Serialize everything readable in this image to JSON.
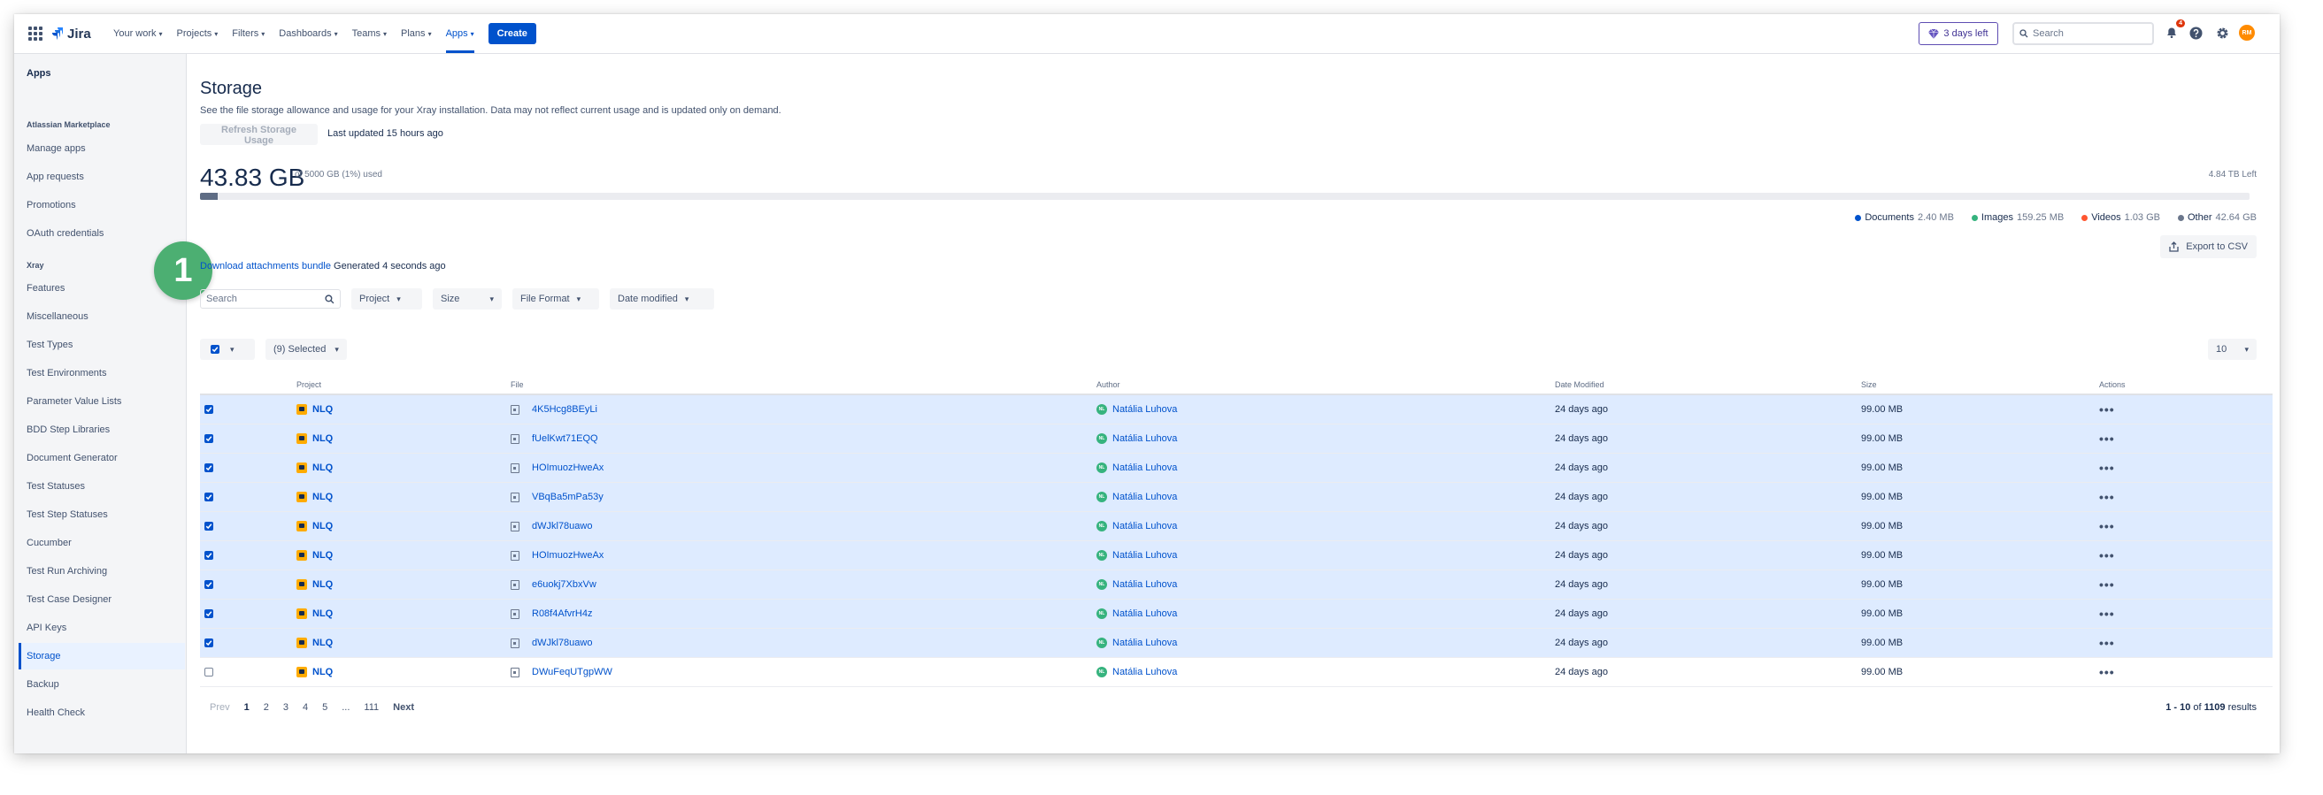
{
  "nav": {
    "logo": "Jira",
    "items": [
      {
        "label": "Your work"
      },
      {
        "label": "Projects"
      },
      {
        "label": "Filters"
      },
      {
        "label": "Dashboards"
      },
      {
        "label": "Teams"
      },
      {
        "label": "Plans"
      },
      {
        "label": "Apps",
        "active": true
      }
    ],
    "create_label": "Create",
    "trial_label": "3 days left",
    "search_placeholder": "Search",
    "notifications_count": "4",
    "avatar_initials": "RM"
  },
  "sidebar": {
    "title": "Apps",
    "sections": [
      {
        "label": "Atlassian Marketplace",
        "items": [
          "Manage apps",
          "App requests",
          "Promotions",
          "OAuth credentials"
        ]
      },
      {
        "label": "Xray",
        "items": [
          "Features",
          "Miscellaneous",
          "Test Types",
          "Test Environments",
          "Parameter Value Lists",
          "BDD Step Libraries",
          "Document Generator",
          "Test Statuses",
          "Test Step Statuses",
          "Cucumber",
          "Test Run Archiving",
          "Test Case Designer",
          "API Keys",
          "Storage",
          "Backup",
          "Health Check"
        ]
      }
    ],
    "active_item": "Storage"
  },
  "page": {
    "title": "Storage",
    "description": "See the file storage allowance and usage for your Xray installation. Data may not reflect current usage and is updated only on demand.",
    "refresh_label": "Refresh Storage Usage",
    "last_updated": "Last updated 15 hours ago",
    "used_amount": "43.83 GB",
    "used_of": "of 5000 GB (1%) used",
    "left_amount": "4.84 TB Left",
    "usage_fraction": 0.0088,
    "legend": [
      {
        "label": "Documents",
        "value": "2.40 MB",
        "color": "#0052cc"
      },
      {
        "label": "Images",
        "value": "159.25 MB",
        "color": "#36b37e"
      },
      {
        "label": "Videos",
        "value": "1.03 GB",
        "color": "#ff5630"
      },
      {
        "label": "Other",
        "value": "42.64 GB",
        "color": "#6b778c"
      }
    ],
    "export_label": "Export to CSV",
    "callout_number": "1",
    "download_link": "Download attachments bundle",
    "download_generated": "Generated 4 seconds ago"
  },
  "filters": {
    "search_placeholder": "Search",
    "project": "Project",
    "size": "Size",
    "file_format": "File Format",
    "date_modified": "Date modified"
  },
  "bulk": {
    "selected_label": "(9) Selected",
    "page_size": "10"
  },
  "table": {
    "headers": [
      "Project",
      "File",
      "Author",
      "Date Modified",
      "Size",
      "Actions"
    ],
    "rows": [
      {
        "checked": true,
        "project": "NLQ",
        "file": "4K5Hcg8BEyLi",
        "author": "Natália Luhova",
        "initials": "NL",
        "date": "24 days ago",
        "size": "99.00 MB"
      },
      {
        "checked": true,
        "project": "NLQ",
        "file": "fUelKwt71EQQ",
        "author": "Natália Luhova",
        "initials": "NL",
        "date": "24 days ago",
        "size": "99.00 MB"
      },
      {
        "checked": true,
        "project": "NLQ",
        "file": "HOImuozHweAx",
        "author": "Natália Luhova",
        "initials": "NL",
        "date": "24 days ago",
        "size": "99.00 MB"
      },
      {
        "checked": true,
        "project": "NLQ",
        "file": "VBqBa5mPa53y",
        "author": "Natália Luhova",
        "initials": "NL",
        "date": "24 days ago",
        "size": "99.00 MB"
      },
      {
        "checked": true,
        "project": "NLQ",
        "file": "dWJkl78uawo",
        "author": "Natália Luhova",
        "initials": "NL",
        "date": "24 days ago",
        "size": "99.00 MB"
      },
      {
        "checked": true,
        "project": "NLQ",
        "file": "HOImuozHweAx",
        "author": "Natália Luhova",
        "initials": "NL",
        "date": "24 days ago",
        "size": "99.00 MB"
      },
      {
        "checked": true,
        "project": "NLQ",
        "file": "e6uokj7XbxVw",
        "author": "Natália Luhova",
        "initials": "NL",
        "date": "24 days ago",
        "size": "99.00 MB"
      },
      {
        "checked": true,
        "project": "NLQ",
        "file": "R08f4AfvrH4z",
        "author": "Natália Luhova",
        "initials": "NL",
        "date": "24 days ago",
        "size": "99.00 MB"
      },
      {
        "checked": true,
        "project": "NLQ",
        "file": "dWJkl78uawo",
        "author": "Natália Luhova",
        "initials": "NL",
        "date": "24 days ago",
        "size": "99.00 MB"
      },
      {
        "checked": false,
        "project": "NLQ",
        "file": "DWuFeqUTgpWW",
        "author": "Natália Luhova",
        "initials": "NL",
        "date": "24 days ago",
        "size": "99.00 MB"
      }
    ]
  },
  "pagination": {
    "prev": "Prev",
    "pages": [
      "1",
      "2",
      "3",
      "4",
      "5",
      "...",
      "111"
    ],
    "current": "1",
    "next": "Next",
    "results_range": "1 - 10",
    "results_of": "of",
    "results_total": "1109",
    "results_suffix": "results"
  }
}
